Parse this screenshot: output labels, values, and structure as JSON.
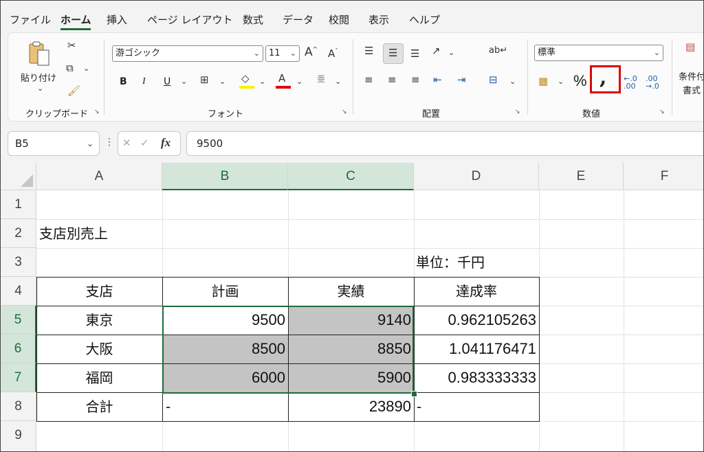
{
  "menu": {
    "tabs": [
      "ファイル",
      "ホーム",
      "挿入",
      "ページ レイアウト",
      "数式",
      "データ",
      "校閲",
      "表示",
      "ヘルプ"
    ],
    "active": "ホーム"
  },
  "ribbon": {
    "clipboard": {
      "label": "クリップボード",
      "paste_label": "貼り付け"
    },
    "font": {
      "label": "フォント",
      "font_name": "游ゴシック",
      "font_size": "11",
      "bold": "B",
      "italic": "I",
      "underline": "U"
    },
    "alignment": {
      "label": "配置"
    },
    "number": {
      "label": "数値",
      "format": "標準",
      "percent": "%",
      "comma": ","
    },
    "styles": {
      "conditional_line1": "条件付",
      "conditional_line2": "書式"
    }
  },
  "formula_bar": {
    "name_box": "B5",
    "fx": "fx",
    "formula": "9500"
  },
  "columns": [
    "A",
    "B",
    "C",
    "D",
    "E",
    "F"
  ],
  "rows": [
    "1",
    "2",
    "3",
    "4",
    "5",
    "6",
    "7",
    "8",
    "9"
  ],
  "cells": {
    "A2": "支店別売上",
    "D3": "単位：千円",
    "A4": "支店",
    "B4": "計画",
    "C4": "実績",
    "D4": "達成率",
    "A5": "東京",
    "B5": "9500",
    "C5": "9140",
    "D5": "0.962105263",
    "A6": "大阪",
    "B6": "8500",
    "C6": "8850",
    "D6": "1.041176471",
    "A7": "福岡",
    "B7": "6000",
    "C7": "5900",
    "D7": "0.983333333",
    "A8": "合計",
    "B8": "-",
    "C8": "23890",
    "D8": "-"
  },
  "colors": {
    "accent": "#1e6b3a",
    "selection_fill": "#c4c4c4",
    "highlight_box": "#e00000"
  }
}
